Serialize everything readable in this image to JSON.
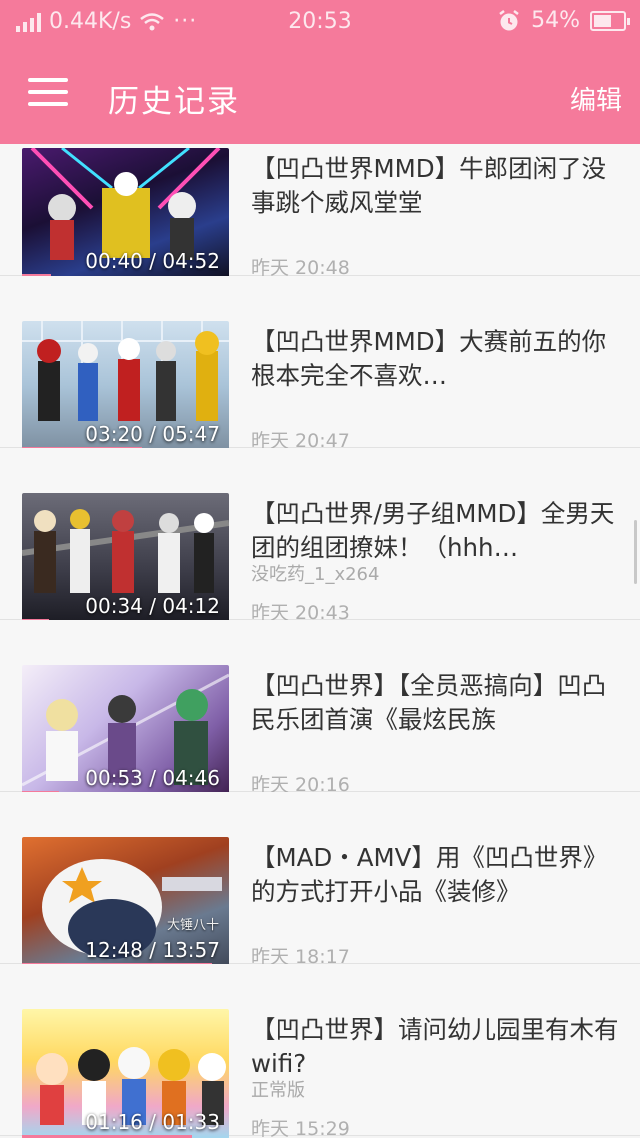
{
  "status_bar": {
    "speed": "0.44K/s",
    "more": "···",
    "time": "20:53",
    "battery": "54%",
    "battery_level": 0.54
  },
  "header": {
    "menu_icon": "hamburger-icon",
    "title": "历史记录",
    "edit_label": "编辑",
    "color": "#f57a9b"
  },
  "items": [
    {
      "title": "【凹凸世界MMD】牛郎团闲了没事跳个威风堂堂",
      "subtitle": "",
      "time": "昨天 20:48",
      "duration": "00:40 / 04:52",
      "progress": 0.14,
      "watermark": ""
    },
    {
      "title": "【凹凸世界MMD】大赛前五的你根本完全不喜欢…",
      "subtitle": "",
      "time": "昨天 20:47",
      "duration": "03:20 / 05:47",
      "progress": 0.58,
      "watermark": ""
    },
    {
      "title": "【凹凸世界/男子组MMD】全男天团的组团撩妹！（hhh…",
      "subtitle": "没吃药_1_x264",
      "time": "昨天 20:43",
      "duration": "00:34 / 04:12",
      "progress": 0.13,
      "watermark": ""
    },
    {
      "title": "【凹凸世界】【全员恶搞向】凹凸民乐团首演《最炫民族",
      "subtitle": "",
      "time": "昨天 20:16",
      "duration": "00:53 / 04:46",
      "progress": 0.18,
      "watermark": ""
    },
    {
      "title": "【MAD・AMV】用《凹凸世界》的方式打开小品《装修》",
      "subtitle": "",
      "time": "昨天 18:17",
      "duration": "12:48 / 13:57",
      "progress": 0.92,
      "watermark": "大锤八十"
    },
    {
      "title": "【凹凸世界】请问幼儿园里有木有wifi?",
      "subtitle": "正常版",
      "time": "昨天 15:29",
      "duration": "01:16 / 01:33",
      "progress": 0.82,
      "watermark": ""
    }
  ]
}
